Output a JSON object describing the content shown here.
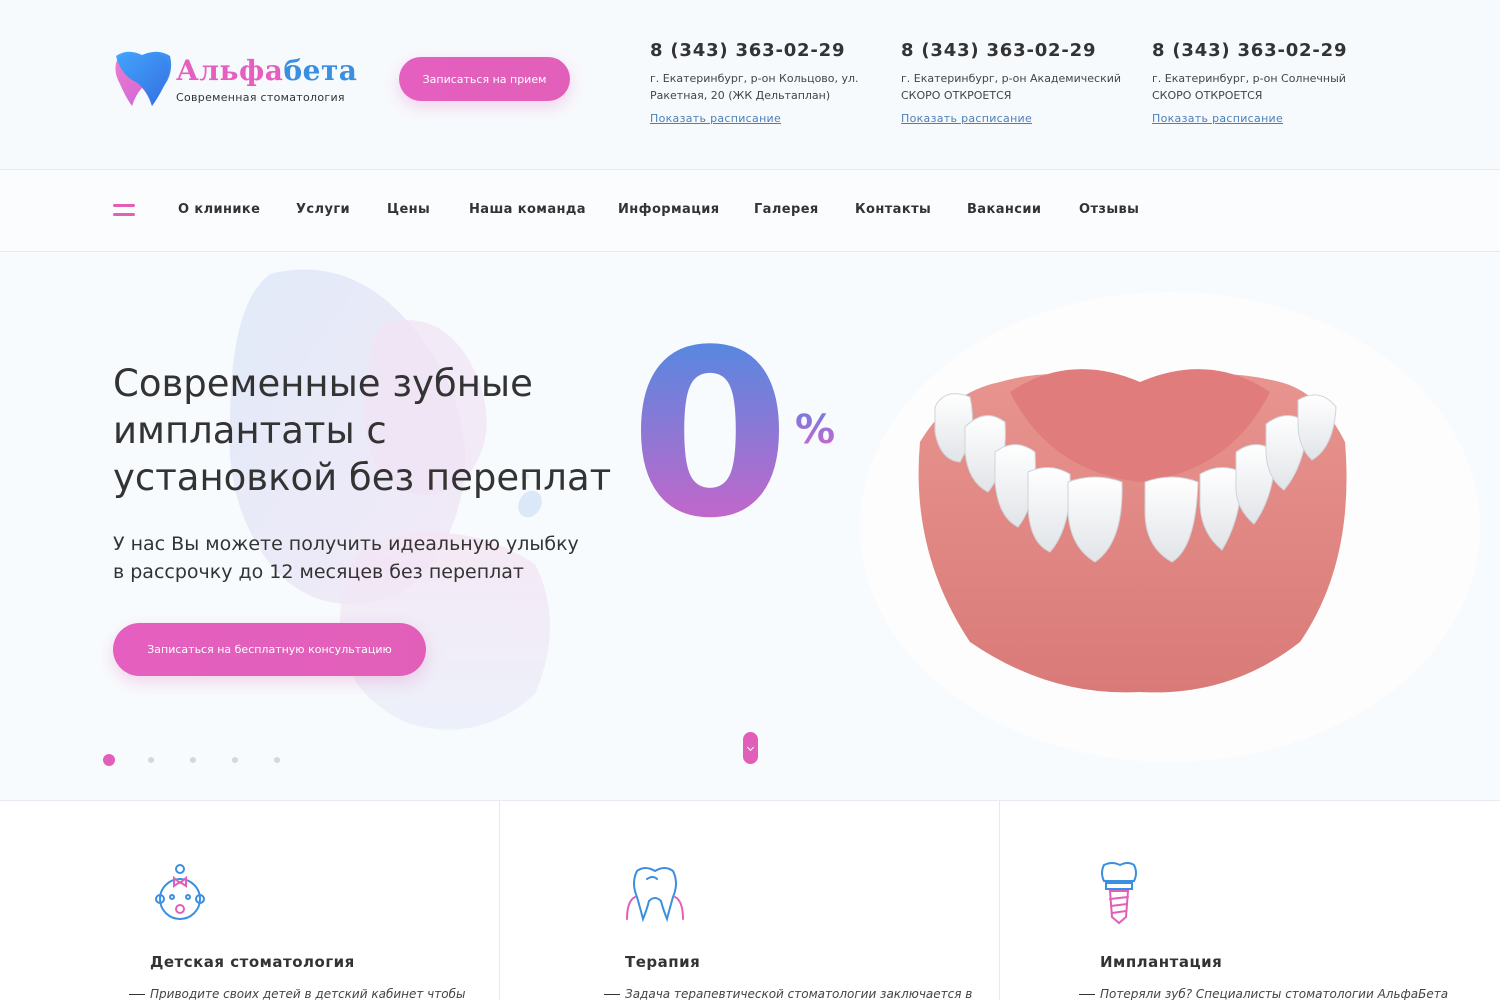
{
  "header": {
    "logo_name_part1": "Альфа",
    "logo_name_part2": "бета",
    "logo_tagline": "Современная стоматология",
    "appoint_button": "Записаться на прием",
    "contacts": [
      {
        "phone": "8 (343) 363-02-29",
        "address": "г. Екатеринбург, р-он Кольцово, ул. Ракетная, 20 (ЖК Дельтаплан)",
        "schedule_link": "Показать расписание"
      },
      {
        "phone": "8 (343) 363-02-29",
        "address": "г. Екатеринбург, р-он Академический СКОРО ОТКРОЕТСЯ",
        "schedule_link": "Показать расписание"
      },
      {
        "phone": "8 (343) 363-02-29",
        "address": "г. Екатеринбург, р-он Солнечный СКОРО ОТКРОЕТСЯ",
        "schedule_link": "Показать расписание"
      }
    ]
  },
  "nav": {
    "items": [
      "О клинике",
      "Услуги",
      "Цены",
      "Наша команда",
      "Информация",
      "Галерея",
      "Контакты",
      "Вакансии",
      "Отзывы"
    ]
  },
  "hero": {
    "title": "Современные зубные имплантаты с установкой без переплат",
    "subtitle": "У нас Вы можете получить идеальную улыбку в рассрочку до 12 месяцев без переплат",
    "cta_button": "Записаться на бесплатную консультацию",
    "big_number": "0",
    "percent_sign": "%",
    "slides_total": 5,
    "active_slide": 1
  },
  "services": [
    {
      "title": "Детская стоматология",
      "description": "Приводите своих детей в детский кабинет чтобы",
      "icon": "baby-icon"
    },
    {
      "title": "Терапия",
      "description": "Задача терапевтической стоматологии заключается в",
      "icon": "tooth-icon"
    },
    {
      "title": "Имплантация",
      "description": "Потеряли зуб? Специалисты стоматологии АльфаБета",
      "icon": "implant-icon"
    }
  ],
  "colors": {
    "accent_pink": "#e25fb9",
    "accent_blue": "#3a8fe0",
    "link_blue": "#4c7fb8",
    "text": "#333333"
  }
}
